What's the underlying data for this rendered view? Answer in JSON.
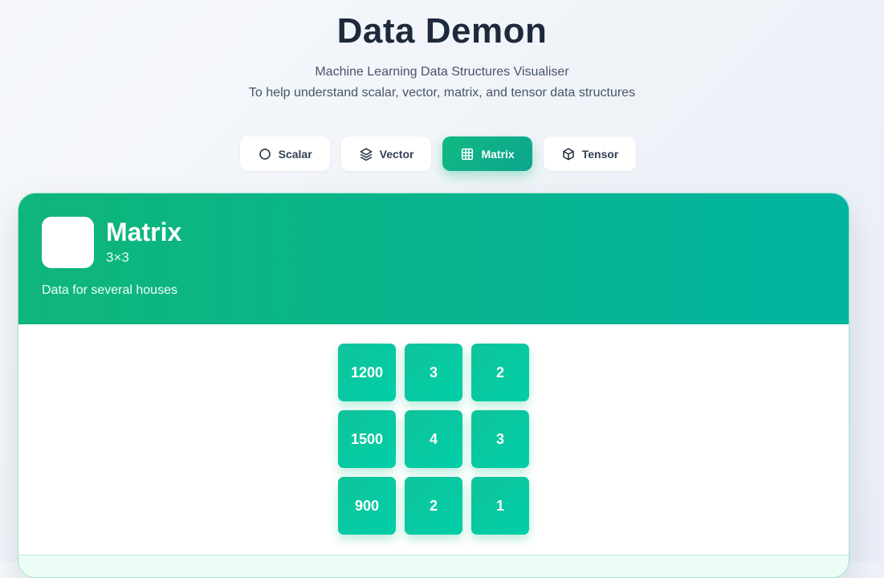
{
  "header": {
    "title": "Data Demon",
    "subtitle": "Machine Learning Data Structures Visualiser",
    "description": "To help understand scalar, vector, matrix, and tensor data structures"
  },
  "tabs": [
    {
      "label": "Scalar",
      "icon": "circle-icon",
      "active": false
    },
    {
      "label": "Vector",
      "icon": "layers-icon",
      "active": false
    },
    {
      "label": "Matrix",
      "icon": "grid-icon",
      "active": true
    },
    {
      "label": "Tensor",
      "icon": "cube-icon",
      "active": false
    }
  ],
  "card": {
    "title": "Matrix",
    "dimensions": "3×3",
    "description": "Data for several houses",
    "matrix": [
      [
        "1200",
        "3",
        "2"
      ],
      [
        "1500",
        "4",
        "3"
      ],
      [
        "900",
        "2",
        "1"
      ]
    ]
  },
  "colors": {
    "accent": "#10b981",
    "accent_teal": "#00b49f",
    "text_dark": "#1e293b"
  }
}
